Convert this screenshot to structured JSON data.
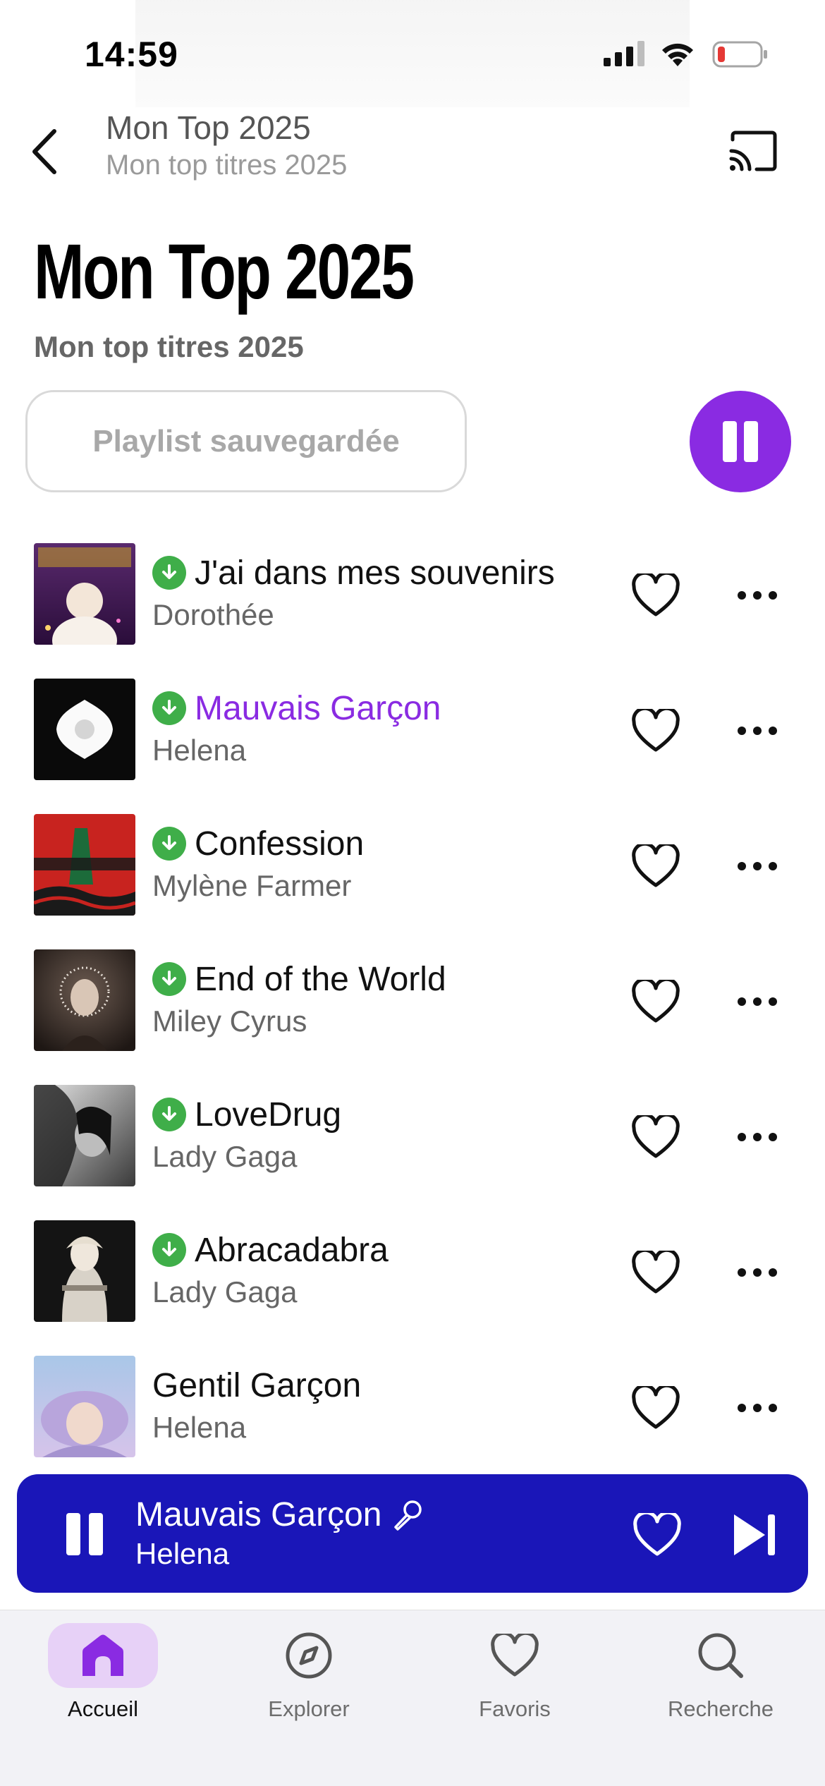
{
  "status_bar": {
    "time": "14:59"
  },
  "header": {
    "back_icon": "chevron-left-icon",
    "title": "Mon Top 2025",
    "subtitle": "Mon top titres 2025",
    "cast_icon": "cast-icon"
  },
  "page": {
    "title": "Mon Top 2025",
    "subtitle": "Mon top titres 2025",
    "saved_label": "Playlist sauvegardée",
    "accent_color": "#8a2be2"
  },
  "tracks": [
    {
      "title": "J'ai dans mes souvenirs",
      "artist": "Dorothée",
      "downloaded": true,
      "playing": false
    },
    {
      "title": "Mauvais Garçon",
      "artist": "Helena",
      "downloaded": true,
      "playing": true
    },
    {
      "title": "Confession",
      "artist": "Mylène Farmer",
      "downloaded": true,
      "playing": false
    },
    {
      "title": "End of the World",
      "artist": "Miley Cyrus",
      "downloaded": true,
      "playing": false
    },
    {
      "title": "LoveDrug",
      "artist": "Lady Gaga",
      "downloaded": true,
      "playing": false
    },
    {
      "title": "Abracadabra",
      "artist": "Lady Gaga",
      "downloaded": true,
      "playing": false
    },
    {
      "title": "Gentil Garçon",
      "artist": "Helena",
      "downloaded": false,
      "playing": false
    }
  ],
  "mini_player": {
    "title": "Mauvais Garçon",
    "artist": "Helena",
    "background_color": "#1a16b8"
  },
  "tabs": [
    {
      "label": "Accueil",
      "icon": "home-icon",
      "active": true
    },
    {
      "label": "Explorer",
      "icon": "compass-icon",
      "active": false
    },
    {
      "label": "Favoris",
      "icon": "heart-icon",
      "active": false
    },
    {
      "label": "Recherche",
      "icon": "search-icon",
      "active": false
    }
  ]
}
